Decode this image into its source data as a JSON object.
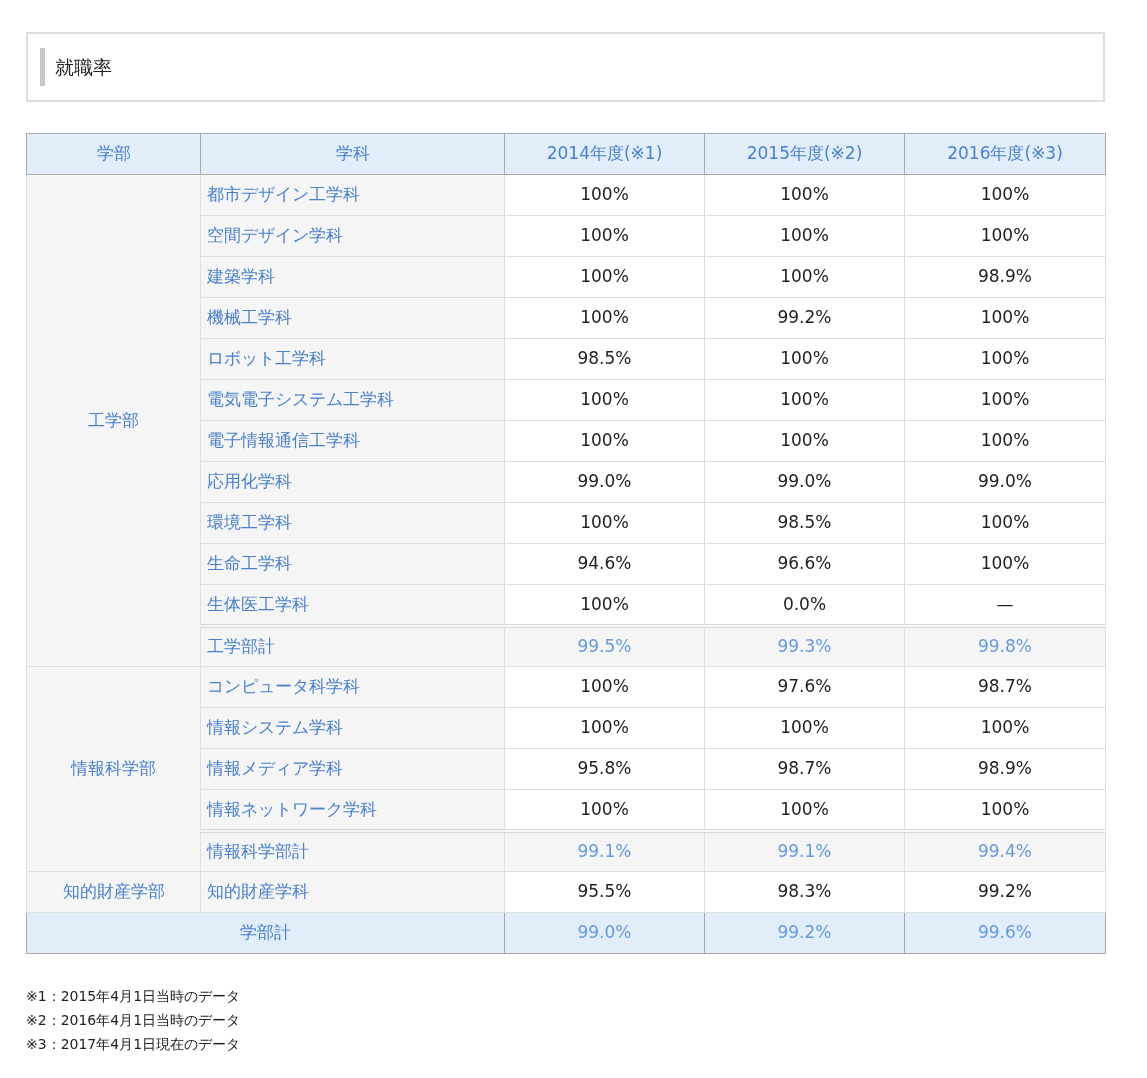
{
  "heading": "就職率",
  "table": {
    "columns": [
      "学部",
      "学科",
      "2014年度(※1)",
      "2015年度(※2)",
      "2016年度(※3)"
    ],
    "faculties": [
      {
        "name": "工学部",
        "rows": [
          {
            "kind": "department",
            "name": "都市デザイン工学科",
            "values": [
              "100%",
              "100%",
              "100%"
            ]
          },
          {
            "kind": "department",
            "name": "空間デザイン学科",
            "values": [
              "100%",
              "100%",
              "100%"
            ]
          },
          {
            "kind": "department",
            "name": "建築学科",
            "values": [
              "100%",
              "100%",
              "98.9%"
            ]
          },
          {
            "kind": "department",
            "name": "機械工学科",
            "values": [
              "100%",
              "99.2%",
              "100%"
            ]
          },
          {
            "kind": "department",
            "name": "ロボット工学科",
            "values": [
              "98.5%",
              "100%",
              "100%"
            ]
          },
          {
            "kind": "department",
            "name": "電気電子システム工学科",
            "values": [
              "100%",
              "100%",
              "100%"
            ]
          },
          {
            "kind": "department",
            "name": "電子情報通信工学科",
            "values": [
              "100%",
              "100%",
              "100%"
            ]
          },
          {
            "kind": "department",
            "name": "応用化学科",
            "values": [
              "99.0%",
              "99.0%",
              "99.0%"
            ]
          },
          {
            "kind": "department",
            "name": "環境工学科",
            "values": [
              "100%",
              "98.5%",
              "100%"
            ]
          },
          {
            "kind": "department",
            "name": "生命工学科",
            "values": [
              "94.6%",
              "96.6%",
              "100%"
            ]
          },
          {
            "kind": "department",
            "name": "生体医工学科",
            "values": [
              "100%",
              "0.0%",
              "—"
            ]
          },
          {
            "kind": "subtotal",
            "name": "工学部計",
            "values": [
              "99.5%",
              "99.3%",
              "99.8%"
            ]
          }
        ]
      },
      {
        "name": "情報科学部",
        "rows": [
          {
            "kind": "department",
            "name": "コンピュータ科学科",
            "values": [
              "100%",
              "97.6%",
              "98.7%"
            ]
          },
          {
            "kind": "department",
            "name": "情報システム学科",
            "values": [
              "100%",
              "100%",
              "100%"
            ]
          },
          {
            "kind": "department",
            "name": "情報メディア学科",
            "values": [
              "95.8%",
              "98.7%",
              "98.9%"
            ]
          },
          {
            "kind": "department",
            "name": "情報ネットワーク学科",
            "values": [
              "100%",
              "100%",
              "100%"
            ]
          },
          {
            "kind": "subtotal",
            "name": "情報科学部計",
            "values": [
              "99.1%",
              "99.1%",
              "99.4%"
            ]
          }
        ]
      },
      {
        "name": "知的財産学部",
        "rows": [
          {
            "kind": "department",
            "name": "知的財産学科",
            "values": [
              "95.5%",
              "98.3%",
              "99.2%"
            ]
          }
        ]
      }
    ],
    "total": {
      "label": "学部計",
      "values": [
        "99.0%",
        "99.2%",
        "99.6%"
      ]
    }
  },
  "notes": [
    "※1：2015年4月1日当時のデータ",
    "※2：2016年4月1日当時のデータ",
    "※3：2017年4月1日現在のデータ"
  ]
}
